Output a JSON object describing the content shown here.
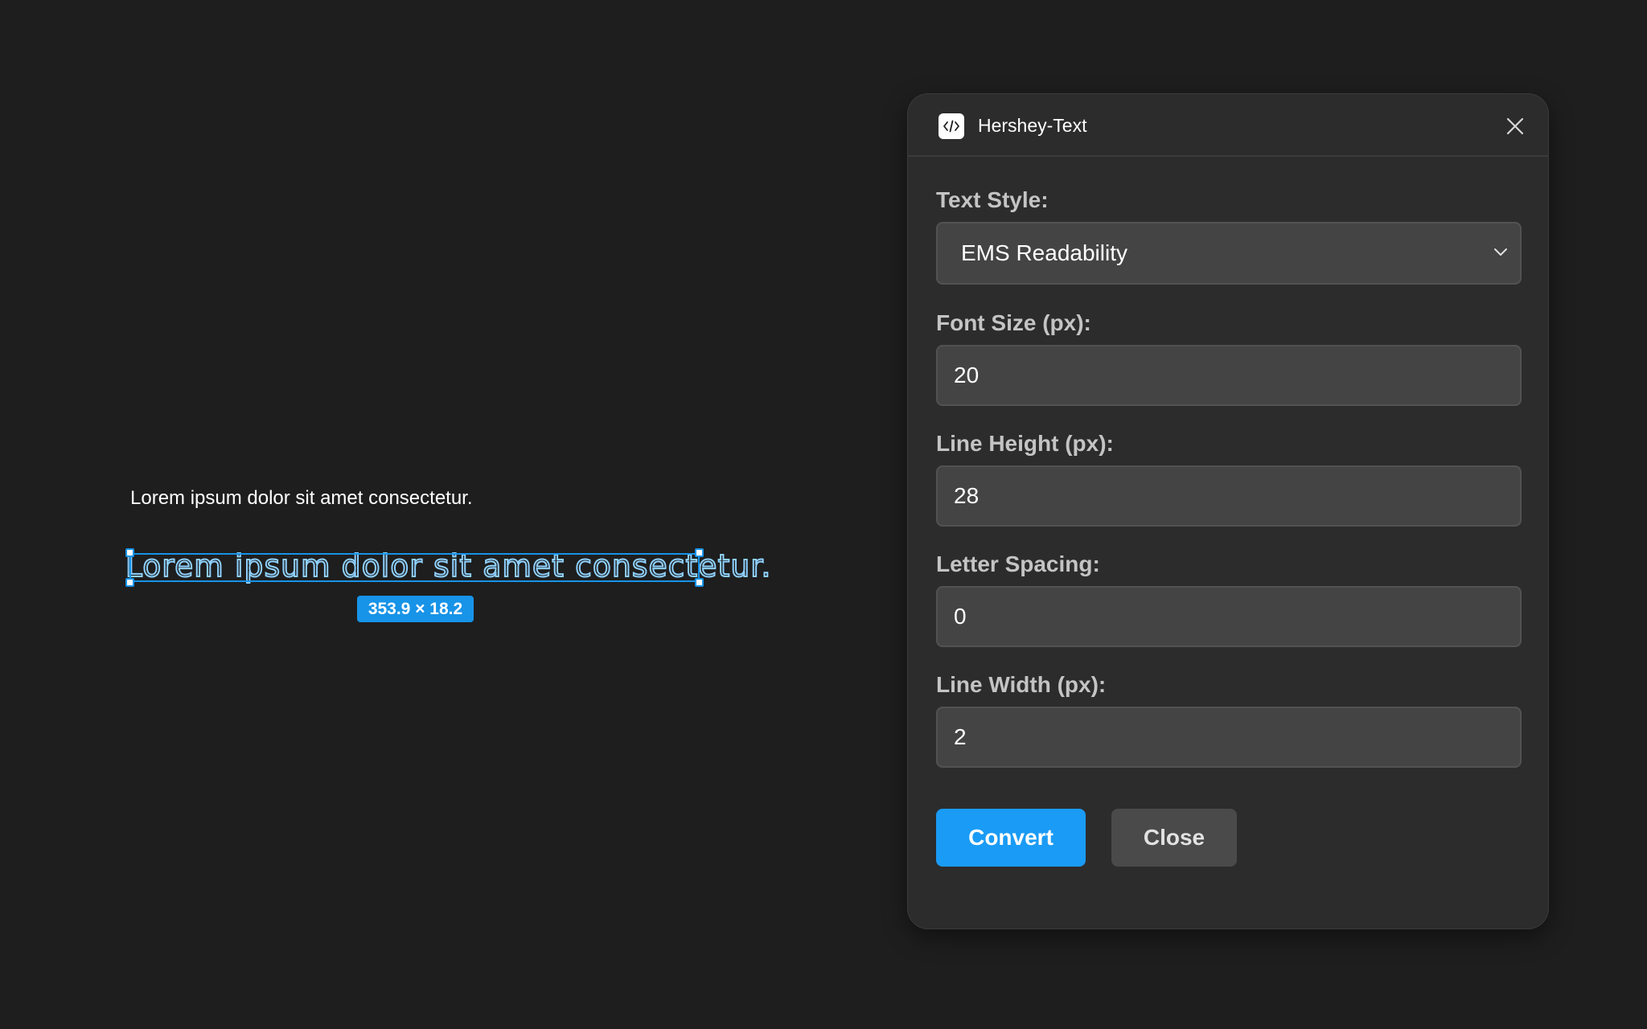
{
  "canvas": {
    "plain_text": "Lorem ipsum dolor sit amet consectetur.",
    "converted_text": "Lorem ipsum dolor sit amet consectetur.",
    "selection_dimensions": "353.9 × 18.2",
    "selection_color": "#1793e8"
  },
  "plugin": {
    "title": "Hershey-Text",
    "icon": "code-icon",
    "close_icon": "close-icon",
    "fields": {
      "text_style": {
        "label": "Text Style:",
        "value": "EMS Readability"
      },
      "font_size": {
        "label": "Font Size (px):",
        "value": "20"
      },
      "line_height": {
        "label": "Line Height (px):",
        "value": "28"
      },
      "letter_spacing": {
        "label": "Letter Spacing:",
        "value": "0"
      },
      "line_width": {
        "label": "Line Width (px):",
        "value": "2"
      }
    },
    "buttons": {
      "convert_label": "Convert",
      "close_label": "Close"
    },
    "accent_color": "#1a9bf5"
  }
}
